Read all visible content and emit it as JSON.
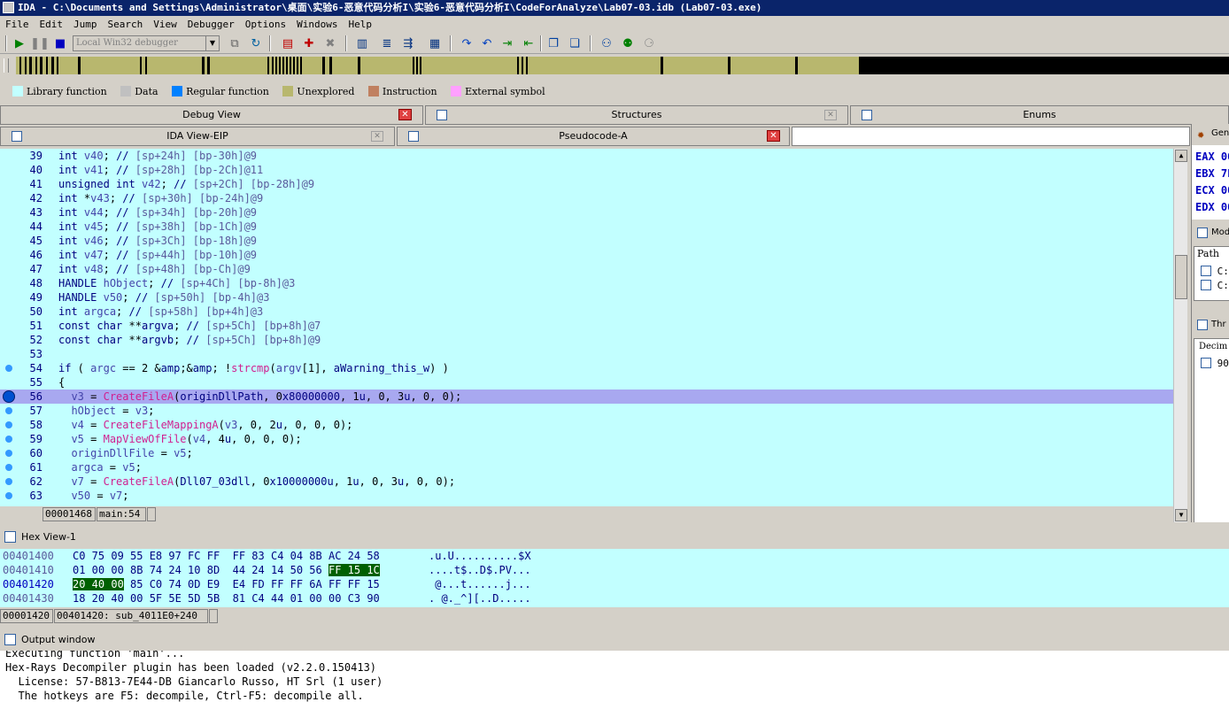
{
  "window": {
    "title": "IDA - C:\\Documents and Settings\\Administrator\\桌面\\实验6-恶意代码分析I\\实验6-恶意代码分析I\\CodeForAnalyze\\Lab07-03.idb (Lab07-03.exe)"
  },
  "menu": [
    "File",
    "Edit",
    "Jump",
    "Search",
    "View",
    "Debugger",
    "Options",
    "Windows",
    "Help"
  ],
  "toolbar": {
    "debugger_select": "Local Win32 debugger"
  },
  "legend": [
    {
      "label": "Library function",
      "color": "#c2ffff"
    },
    {
      "label": "Data",
      "color": "#c0c0c0"
    },
    {
      "label": "Regular function",
      "color": "#0080ff"
    },
    {
      "label": "Unexplored",
      "color": "#b8b76e"
    },
    {
      "label": "Instruction",
      "color": "#c08060"
    },
    {
      "label": "External symbol",
      "color": "#ffa0ff"
    }
  ],
  "tabs_top": [
    "Debug View",
    "Structures",
    "Enums"
  ],
  "tabs_second": [
    "IDA View-EIP",
    "Pseudocode-A"
  ],
  "pseudocode": {
    "lines": [
      {
        "n": "39",
        "dot": false,
        "code": "int v40; // [sp+24h] [bp-30h]@9"
      },
      {
        "n": "40",
        "dot": false,
        "code": "int v41; // [sp+28h] [bp-2Ch]@11"
      },
      {
        "n": "41",
        "dot": false,
        "code": "unsigned int v42; // [sp+2Ch] [bp-28h]@9"
      },
      {
        "n": "42",
        "dot": false,
        "code": "int *v43; // [sp+30h] [bp-24h]@9"
      },
      {
        "n": "43",
        "dot": false,
        "code": "int v44; // [sp+34h] [bp-20h]@9"
      },
      {
        "n": "44",
        "dot": false,
        "code": "int v45; // [sp+38h] [bp-1Ch]@9"
      },
      {
        "n": "45",
        "dot": false,
        "code": "int v46; // [sp+3Ch] [bp-18h]@9"
      },
      {
        "n": "46",
        "dot": false,
        "code": "int v47; // [sp+44h] [bp-10h]@9"
      },
      {
        "n": "47",
        "dot": false,
        "code": "int v48; // [sp+48h] [bp-Ch]@9"
      },
      {
        "n": "48",
        "dot": false,
        "code": "HANDLE hObject; // [sp+4Ch] [bp-8h]@3"
      },
      {
        "n": "49",
        "dot": false,
        "code": "HANDLE v50; // [sp+50h] [bp-4h]@3"
      },
      {
        "n": "50",
        "dot": false,
        "code": "int argca; // [sp+58h] [bp+4h]@3"
      },
      {
        "n": "51",
        "dot": false,
        "code": "const char **argva; // [sp+5Ch] [bp+8h]@7"
      },
      {
        "n": "52",
        "dot": false,
        "code": "const char **argvb; // [sp+5Ch] [bp+8h]@9"
      },
      {
        "n": "53",
        "dot": false,
        "code": ""
      },
      {
        "n": "54",
        "dot": true,
        "code": "if ( argc == 2 && !strcmp(argv[1], aWarning_this_w) )"
      },
      {
        "n": "55",
        "dot": false,
        "code": "{"
      },
      {
        "n": "56",
        "dot": true,
        "code": "  v3 = CreateFileA(originDllPath, 0x80000000, 1u, 0, 3u, 0, 0);"
      },
      {
        "n": "57",
        "dot": true,
        "code": "  hObject = v3;"
      },
      {
        "n": "58",
        "dot": true,
        "code": "  v4 = CreateFileMappingA(v3, 0, 2u, 0, 0, 0);"
      },
      {
        "n": "59",
        "dot": true,
        "code": "  v5 = MapViewOfFile(v4, 4u, 0, 0, 0);"
      },
      {
        "n": "60",
        "dot": true,
        "code": "  originDllFile = v5;"
      },
      {
        "n": "61",
        "dot": true,
        "code": "  argca = v5;"
      },
      {
        "n": "62",
        "dot": true,
        "code": "  v7 = CreateFileA(Dll07_03dll, 0x10000000u, 1u, 0, 3u, 0, 0);"
      },
      {
        "n": "63",
        "dot": true,
        "code": "  v50 = v7;"
      }
    ],
    "status": {
      "offset": "00001468",
      "location": "main:54"
    }
  },
  "hexview": {
    "title": "Hex View-1",
    "rows": [
      {
        "addr": "00401400",
        "bytes": "C0 75 09 55 E8 97 FC FF  FF 83 C4 04 8B AC 24 58",
        "ascii": ".u.U..........$X"
      },
      {
        "addr": "00401410",
        "bytes": "01 00 00 8B 74 24 10 8D  44 24 14 50 56 ",
        "sel": "FF 15 1C",
        "ascii": "....t$..D$.PV..."
      },
      {
        "addr": "00401420",
        "selpre": "20 40 00",
        "bytes": " 85 C0 74 0D E9  E4 FD FF FF 6A FF FF 15",
        "ascii": " @...t......j..."
      },
      {
        "addr": "00401430",
        "bytes": "18 20 40 00 5F 5E 5D 5B  81 C4 44 01 00 00 C3 90",
        "ascii": ". @._^][..D....."
      }
    ],
    "status": {
      "offset": "00001420",
      "location": "00401420: sub_4011E0+240"
    }
  },
  "output": {
    "title": "Output window",
    "lines": [
      "Executing function 'main'...",
      "Hex-Rays Decompiler plugin has been loaded (v2.2.0.150413)",
      "  License: 57-B813-7E44-DB Giancarlo Russo, HT Srl (1 user)",
      "  The hotkeys are F5: decompile, Ctrl-F5: decompile all."
    ]
  },
  "right": {
    "general": "Gen",
    "regs": [
      "EAX 00",
      "EBX 7F",
      "ECX 00",
      "EDX 00"
    ],
    "modules": "Mod",
    "path": "Path",
    "items": [
      "C:",
      "C:"
    ],
    "threads": "Thr",
    "decimal": "Decim",
    "thread_val": "90"
  }
}
